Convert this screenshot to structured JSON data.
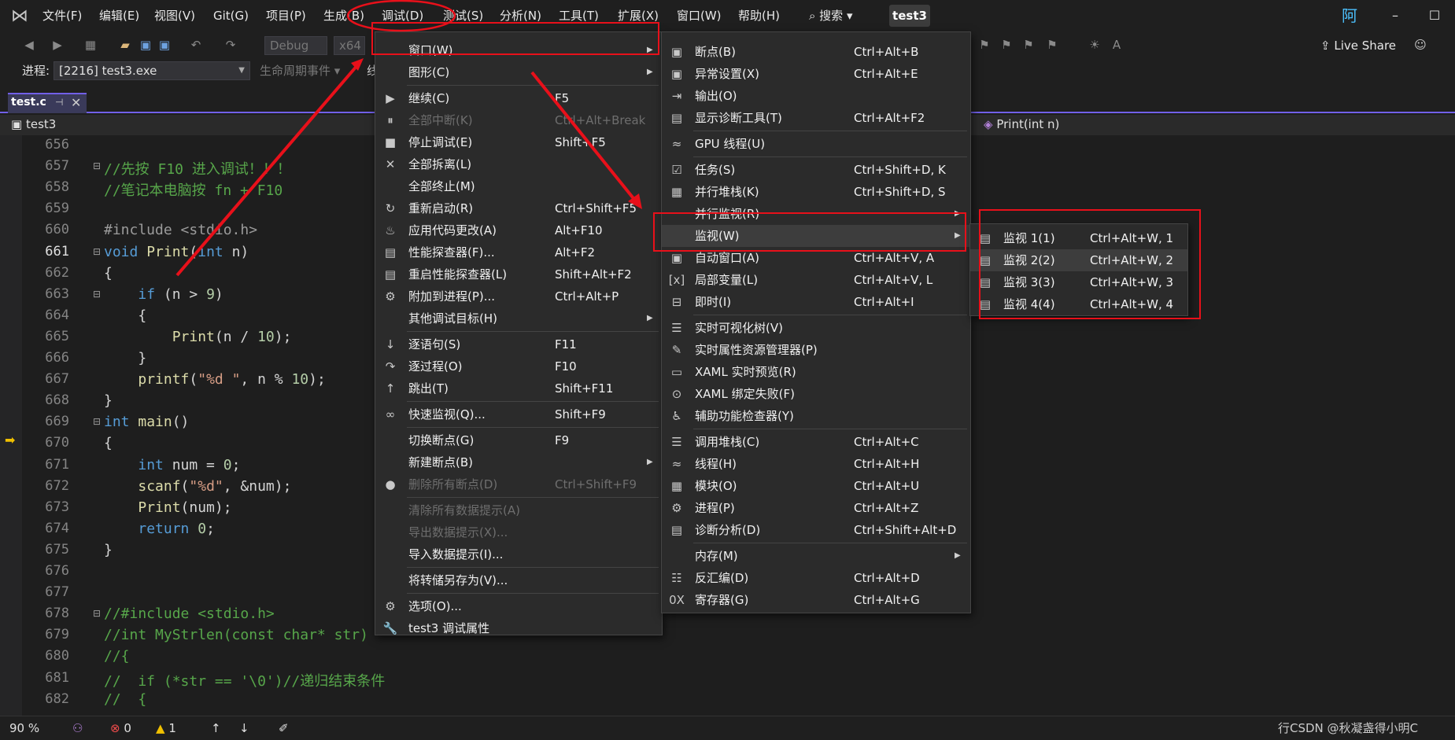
{
  "menubar": {
    "items": [
      "文件(F)",
      "编辑(E)",
      "视图(V)",
      "Git(G)",
      "项目(P)",
      "生成(B)",
      "调试(D)",
      "测试(S)",
      "分析(N)",
      "工具(T)",
      "扩展(X)",
      "窗口(W)",
      "帮助(H)"
    ],
    "search": "搜索",
    "solution": "test3",
    "user_initial": "阿",
    "minimize": "–",
    "maximize": "☐"
  },
  "toolbar": {
    "config": "Debug",
    "platform": "x64",
    "live_share": "Live Share"
  },
  "process_bar": {
    "label": "进程:",
    "value": "[2216] test3.exe",
    "lifecycle": "生命周期事件 ▾",
    "thread_fragment": "线"
  },
  "tab": {
    "name": "test.c"
  },
  "navbar": {
    "project": "test3",
    "function": "Print(int n)"
  },
  "code_lines": [
    {
      "n": "656",
      "text": ""
    },
    {
      "n": "657",
      "text": "//先按 F10 进入调试！！！"
    },
    {
      "n": "658",
      "text": "//笔记本电脑按 fn + F10"
    },
    {
      "n": "659",
      "text": ""
    },
    {
      "n": "660",
      "text": "#include <stdio.h>"
    },
    {
      "n": "661",
      "text": "void Print(int n)"
    },
    {
      "n": "662",
      "text": "{"
    },
    {
      "n": "663",
      "text": "    if (n > 9)"
    },
    {
      "n": "664",
      "text": "    {"
    },
    {
      "n": "665",
      "text": "        Print(n / 10);"
    },
    {
      "n": "666",
      "text": "    }"
    },
    {
      "n": "667",
      "text": "    printf(\"%d \", n % 10);"
    },
    {
      "n": "668",
      "text": "}"
    },
    {
      "n": "669",
      "text": "int main()"
    },
    {
      "n": "670",
      "text": "{"
    },
    {
      "n": "671",
      "text": "    int num = 0;"
    },
    {
      "n": "672",
      "text": "    scanf(\"%d\", &num);"
    },
    {
      "n": "673",
      "text": "    Print(num);"
    },
    {
      "n": "674",
      "text": "    return 0;"
    },
    {
      "n": "675",
      "text": "}"
    },
    {
      "n": "676",
      "text": ""
    },
    {
      "n": "677",
      "text": ""
    },
    {
      "n": "678",
      "text": "//#include <stdio.h>"
    },
    {
      "n": "679",
      "text": "//int MyStrlen(const char* str)"
    },
    {
      "n": "680",
      "text": "//{"
    },
    {
      "n": "681",
      "text": "//  if (*str == '\\0')//递归结束条件"
    },
    {
      "n": "682",
      "text": "//  {"
    }
  ],
  "debug_menu": [
    {
      "label": "窗口(W)",
      "shortcut": "",
      "icon": "window-icon",
      "glyph": "",
      "sub": true,
      "disabled": false
    },
    {
      "label": "图形(C)",
      "shortcut": "",
      "icon": "graphics-icon",
      "glyph": "",
      "sub": true,
      "disabled": false
    },
    {
      "sep": true
    },
    {
      "label": "继续(C)",
      "shortcut": "F5",
      "icon": "play-icon",
      "glyph": "▶",
      "disabled": false
    },
    {
      "label": "全部中断(K)",
      "shortcut": "Ctrl+Alt+Break",
      "icon": "pause-icon",
      "glyph": "⏸",
      "disabled": true
    },
    {
      "label": "停止调试(E)",
      "shortcut": "Shift+F5",
      "icon": "stop-icon",
      "glyph": "■",
      "disabled": false
    },
    {
      "label": "全部拆离(L)",
      "shortcut": "",
      "icon": "detach-icon",
      "glyph": "✕",
      "disabled": false
    },
    {
      "label": "全部终止(M)",
      "shortcut": "",
      "icon": "terminate-icon",
      "glyph": "",
      "disabled": false
    },
    {
      "label": "重新启动(R)",
      "shortcut": "Ctrl+Shift+F5",
      "icon": "restart-icon",
      "glyph": "↻",
      "disabled": false
    },
    {
      "label": "应用代码更改(A)",
      "shortcut": "Alt+F10",
      "icon": "hot-reload-icon",
      "glyph": "♨",
      "disabled": false
    },
    {
      "label": "性能探查器(F)...",
      "shortcut": "Alt+F2",
      "icon": "profiler-icon",
      "glyph": "▤",
      "disabled": false
    },
    {
      "label": "重启性能探查器(L)",
      "shortcut": "Shift+Alt+F2",
      "icon": "profiler-restart-icon",
      "glyph": "▤",
      "disabled": false
    },
    {
      "label": "附加到进程(P)...",
      "shortcut": "Ctrl+Alt+P",
      "icon": "attach-icon",
      "glyph": "⚙",
      "disabled": false
    },
    {
      "label": "其他调试目标(H)",
      "shortcut": "",
      "icon": "other-targets-icon",
      "glyph": "",
      "sub": true,
      "disabled": false
    },
    {
      "sep": true
    },
    {
      "label": "逐语句(S)",
      "shortcut": "F11",
      "icon": "step-into-icon",
      "glyph": "↓",
      "disabled": false
    },
    {
      "label": "逐过程(O)",
      "shortcut": "F10",
      "icon": "step-over-icon",
      "glyph": "↷",
      "disabled": false
    },
    {
      "label": "跳出(T)",
      "shortcut": "Shift+F11",
      "icon": "step-out-icon",
      "glyph": "↑",
      "disabled": false
    },
    {
      "sep": true
    },
    {
      "label": "快速监视(Q)...",
      "shortcut": "Shift+F9",
      "icon": "quickwatch-icon",
      "glyph": "∞",
      "disabled": false
    },
    {
      "sep": true
    },
    {
      "label": "切换断点(G)",
      "shortcut": "F9",
      "icon": "toggle-breakpoint-icon",
      "glyph": "",
      "disabled": false
    },
    {
      "label": "新建断点(B)",
      "shortcut": "",
      "icon": "new-breakpoint-icon",
      "glyph": "",
      "sub": true,
      "disabled": false
    },
    {
      "label": "删除所有断点(D)",
      "shortcut": "Ctrl+Shift+F9",
      "icon": "delete-breakpoints-icon",
      "glyph": "●",
      "disabled": true
    },
    {
      "sep": true
    },
    {
      "label": "清除所有数据提示(A)",
      "shortcut": "",
      "icon": "",
      "glyph": "",
      "disabled": true
    },
    {
      "label": "导出数据提示(X)...",
      "shortcut": "",
      "icon": "",
      "glyph": "",
      "disabled": true
    },
    {
      "label": "导入数据提示(I)...",
      "shortcut": "",
      "icon": "",
      "glyph": "",
      "disabled": false
    },
    {
      "sep": true
    },
    {
      "label": "将转储另存为(V)...",
      "shortcut": "",
      "icon": "",
      "glyph": "",
      "disabled": false
    },
    {
      "sep": true
    },
    {
      "label": "选项(O)...",
      "shortcut": "",
      "icon": "options-gear-icon",
      "glyph": "⚙",
      "disabled": false
    },
    {
      "label": "test3 调试属性",
      "shortcut": "",
      "icon": "wrench-icon",
      "glyph": "🔧",
      "disabled": false
    }
  ],
  "window_menu": [
    {
      "label": "断点(B)",
      "shortcut": "Ctrl+Alt+B",
      "icon": "breakpoints-window-icon",
      "glyph": "▣"
    },
    {
      "label": "异常设置(X)",
      "shortcut": "Ctrl+Alt+E",
      "icon": "exception-icon",
      "glyph": "▣"
    },
    {
      "label": "输出(O)",
      "shortcut": "",
      "icon": "output-icon",
      "glyph": "⇥"
    },
    {
      "label": "显示诊断工具(T)",
      "shortcut": "Ctrl+Alt+F2",
      "icon": "diagnostics-icon",
      "glyph": "▤"
    },
    {
      "sep": true
    },
    {
      "label": "GPU 线程(U)",
      "shortcut": "",
      "icon": "gpu-threads-icon",
      "glyph": "≈"
    },
    {
      "sep": true
    },
    {
      "label": "任务(S)",
      "shortcut": "Ctrl+Shift+D, K",
      "icon": "tasks-icon",
      "glyph": "☑"
    },
    {
      "label": "并行堆栈(K)",
      "shortcut": "Ctrl+Shift+D, S",
      "icon": "parallel-stacks-icon",
      "glyph": "▦"
    },
    {
      "label": "并行监视(R)",
      "shortcut": "",
      "icon": "",
      "glyph": "",
      "sub": true
    },
    {
      "label": "监视(W)",
      "shortcut": "",
      "icon": "",
      "glyph": "",
      "sub": true,
      "hl": true
    },
    {
      "label": "自动窗口(A)",
      "shortcut": "Ctrl+Alt+V, A",
      "icon": "autos-icon",
      "glyph": "▣"
    },
    {
      "label": "局部变量(L)",
      "shortcut": "Ctrl+Alt+V, L",
      "icon": "locals-icon",
      "glyph": "[x]"
    },
    {
      "label": "即时(I)",
      "shortcut": "Ctrl+Alt+I",
      "icon": "immediate-icon",
      "glyph": "⊟"
    },
    {
      "sep": true
    },
    {
      "label": "实时可视化树(V)",
      "shortcut": "",
      "icon": "visual-tree-icon",
      "glyph": "☰"
    },
    {
      "label": "实时属性资源管理器(P)",
      "shortcut": "",
      "icon": "property-explorer-icon",
      "glyph": "✎"
    },
    {
      "label": "XAML 实时预览(R)",
      "shortcut": "",
      "icon": "xaml-preview-icon",
      "glyph": "▭"
    },
    {
      "label": "XAML 绑定失败(F)",
      "shortcut": "",
      "icon": "xaml-binding-icon",
      "glyph": "⊙"
    },
    {
      "label": "辅助功能检查器(Y)",
      "shortcut": "",
      "icon": "accessibility-icon",
      "glyph": "♿"
    },
    {
      "sep": true
    },
    {
      "label": "调用堆栈(C)",
      "shortcut": "Ctrl+Alt+C",
      "icon": "call-stack-icon",
      "glyph": "☰"
    },
    {
      "label": "线程(H)",
      "shortcut": "Ctrl+Alt+H",
      "icon": "threads-icon",
      "glyph": "≈"
    },
    {
      "label": "模块(O)",
      "shortcut": "Ctrl+Alt+U",
      "icon": "modules-icon",
      "glyph": "▦"
    },
    {
      "label": "进程(P)",
      "shortcut": "Ctrl+Alt+Z",
      "icon": "processes-icon",
      "glyph": "⚙"
    },
    {
      "label": "诊断分析(D)",
      "shortcut": "Ctrl+Shift+Alt+D",
      "icon": "diag-analysis-icon",
      "glyph": "▤"
    },
    {
      "sep": true
    },
    {
      "label": "内存(M)",
      "shortcut": "",
      "icon": "",
      "glyph": "",
      "sub": true
    },
    {
      "label": "反汇编(D)",
      "shortcut": "Ctrl+Alt+D",
      "icon": "disassembly-icon",
      "glyph": "☷"
    },
    {
      "label": "寄存器(G)",
      "shortcut": "Ctrl+Alt+G",
      "icon": "registers-icon",
      "glyph": "0X"
    }
  ],
  "watch_menu": [
    {
      "label": "监视 1(1)",
      "shortcut": "Ctrl+Alt+W, 1"
    },
    {
      "label": "监视 2(2)",
      "shortcut": "Ctrl+Alt+W, 2",
      "hl": true
    },
    {
      "label": "监视 3(3)",
      "shortcut": "Ctrl+Alt+W, 3"
    },
    {
      "label": "监视 4(4)",
      "shortcut": "Ctrl+Alt+W, 4"
    }
  ],
  "statusbar": {
    "zoom": "90 %",
    "errors": "0",
    "warnings": "1",
    "right_text": "行CSDN @秋凝盏得小明C"
  },
  "colors": {
    "accent": "#7160e8",
    "annotation_red": "#e8101a",
    "menu_bg": "#2b2b2b"
  }
}
